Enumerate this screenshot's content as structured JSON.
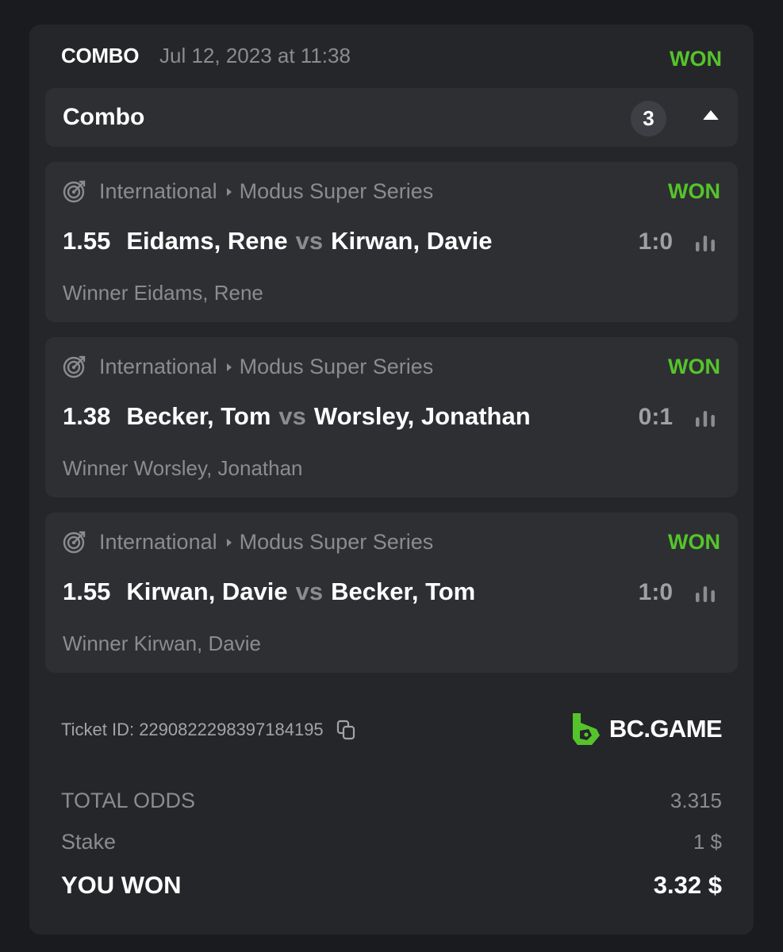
{
  "ticket": {
    "bet_type": "COMBO",
    "date": "Jul 12, 2023 at 11:38",
    "status": "WON",
    "accent_color": "#55c42b"
  },
  "combo_bar": {
    "title": "Combo",
    "count": "3",
    "toggle_icon": "caret-up-icon"
  },
  "legs": [
    {
      "sport_icon": "darts-target-icon",
      "category": "International",
      "tournament": "Modus Super Series",
      "status": "WON",
      "odds": "1.55",
      "home": "Eidams, Rene",
      "vs": "vs",
      "away": "Kirwan, Davie",
      "score": "1:0",
      "selection": "Winner Eidams, Rene"
    },
    {
      "sport_icon": "darts-target-icon",
      "category": "International",
      "tournament": "Modus Super Series",
      "status": "WON",
      "odds": "1.38",
      "home": "Becker, Tom",
      "vs": "vs",
      "away": "Worsley, Jonathan",
      "score": "0:1",
      "selection": "Winner Worsley, Jonathan"
    },
    {
      "sport_icon": "darts-target-icon",
      "category": "International",
      "tournament": "Modus Super Series",
      "status": "WON",
      "odds": "1.55",
      "home": "Kirwan, Davie",
      "vs": "vs",
      "away": "Becker, Tom",
      "score": "1:0",
      "selection": "Winner Kirwan, Davie"
    }
  ],
  "footer": {
    "ticket_id_label": "Ticket ID: 2290822298397184195",
    "brand": "BC.GAME",
    "brand_color": "#55c42b"
  },
  "summary": {
    "total_odds_label": "TOTAL ODDS",
    "total_odds_value": "3.315",
    "stake_label": "Stake",
    "stake_value": "1 $",
    "won_label": "YOU WON",
    "won_value": "3.32 $"
  }
}
